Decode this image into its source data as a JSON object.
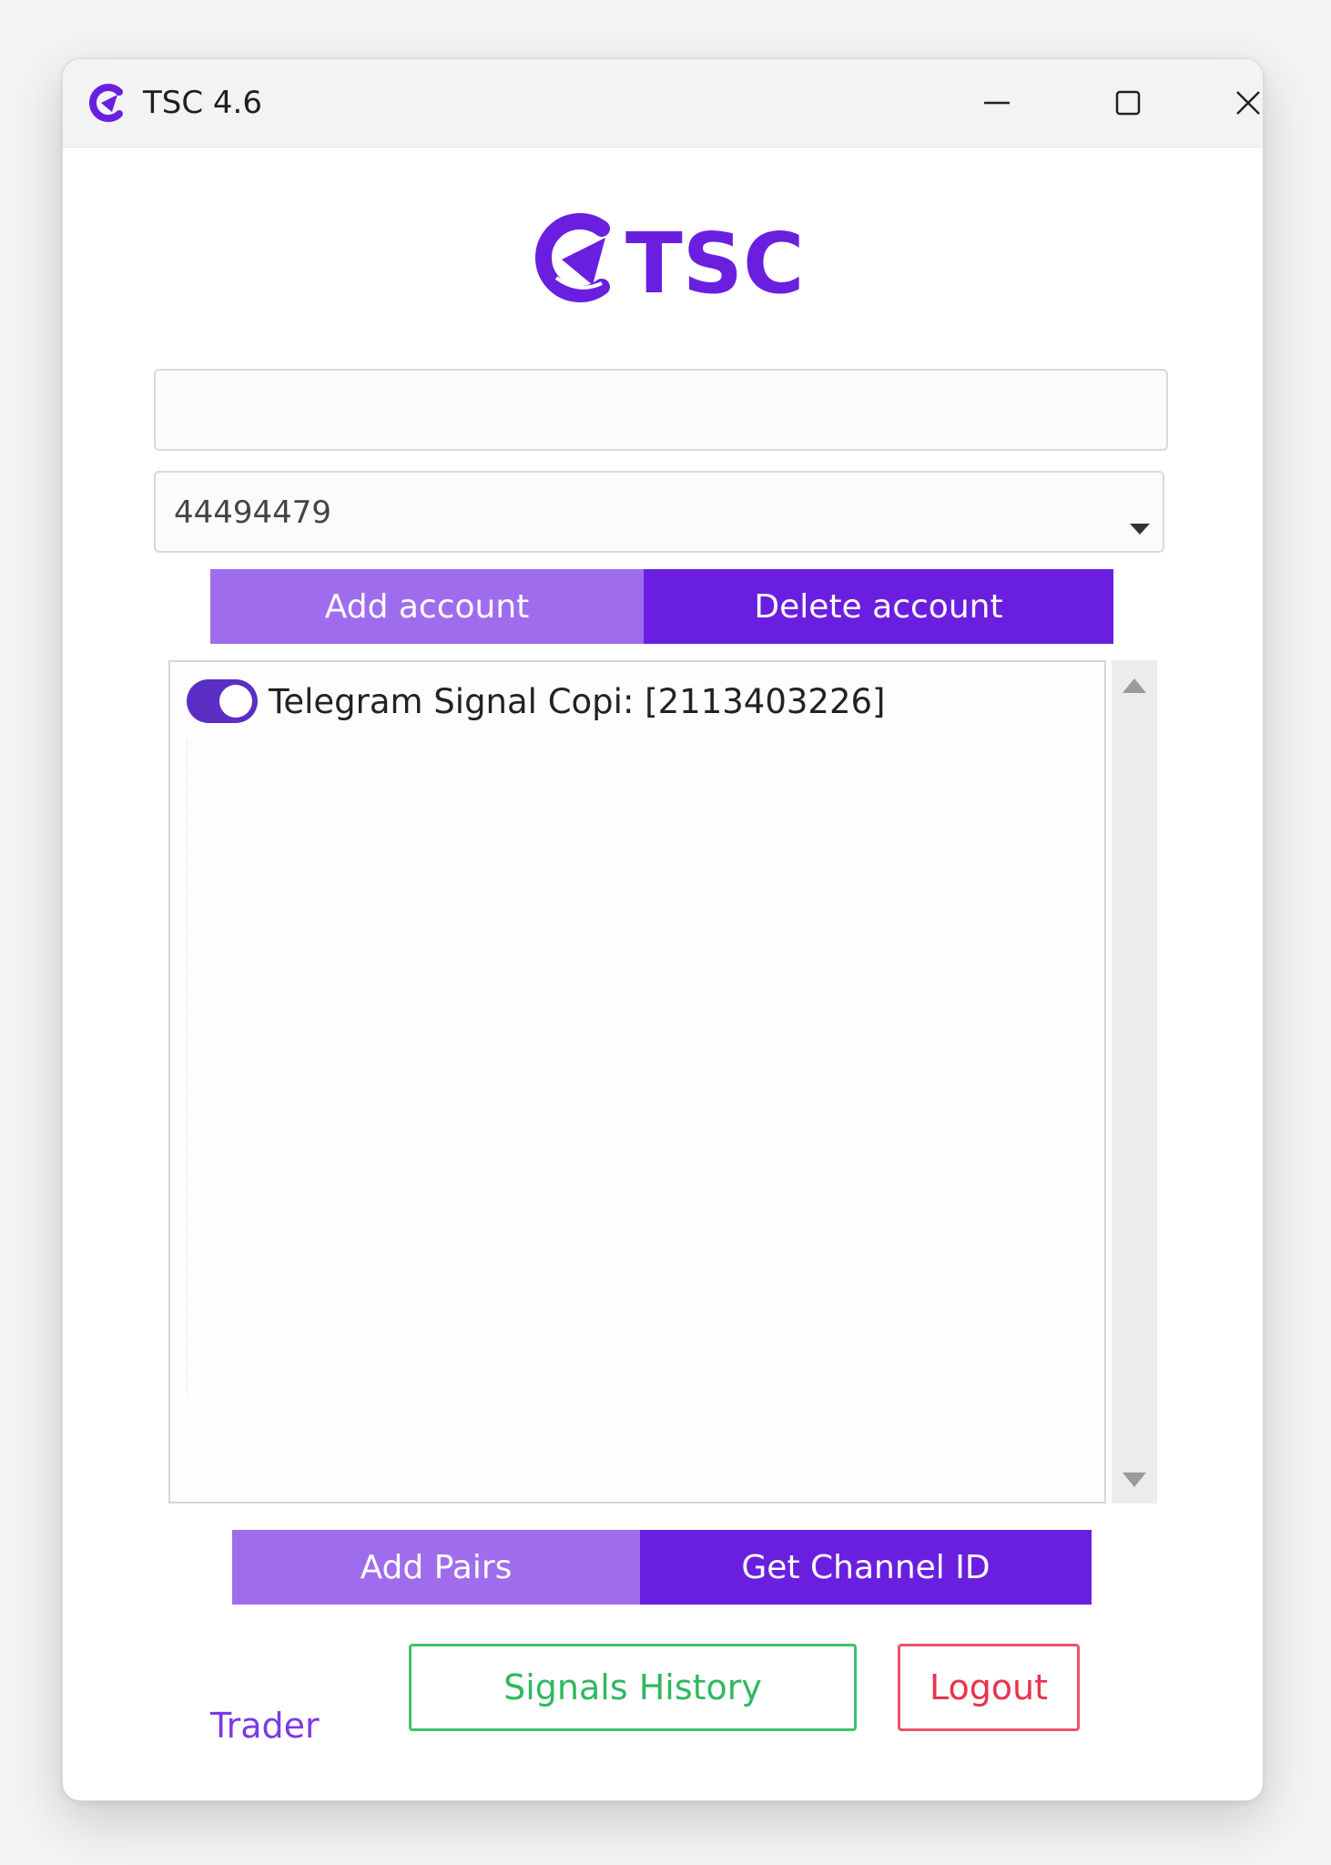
{
  "window": {
    "title": "TSC 4.6"
  },
  "logo": {
    "text": "TSC",
    "brand_color": "#6a1fe0"
  },
  "fields": {
    "top_input_value": "",
    "account_select_value": "44494479"
  },
  "account_buttons": {
    "add": "Add account",
    "delete": "Delete account"
  },
  "channels": {
    "items": [
      {
        "label": "Telegram Signal Copi: [2113403226]",
        "enabled": true
      }
    ]
  },
  "pair_buttons": {
    "add_pairs": "Add Pairs",
    "get_channel_id": "Get Channel ID"
  },
  "footer": {
    "trader": "Trader",
    "signals_history": "Signals History",
    "logout": "Logout"
  },
  "colors": {
    "accent_light": "#a06cee",
    "accent_dark": "#6a1fe0",
    "success": "#3ec06b",
    "danger": "#f0526a"
  }
}
